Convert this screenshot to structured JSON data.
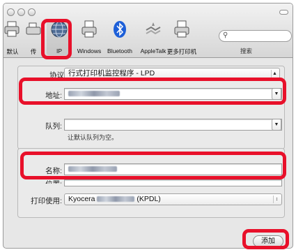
{
  "toolbar": {
    "items": [
      {
        "label": "默认"
      },
      {
        "label": "传"
      },
      {
        "label": "IP"
      },
      {
        "label": "Windows"
      },
      {
        "label": "Bluetooth"
      },
      {
        "label": "AppleTalk"
      },
      {
        "label": "更多打印机"
      }
    ],
    "search_label": "搜索"
  },
  "form": {
    "protocol_label": "协议:",
    "protocol_value": "行式打印机监控程序 - LPD",
    "address_label": "地址:",
    "queue_label": "队列:",
    "queue_hint": "让默认队列为空。",
    "name_label": "名称:",
    "location_label": "位置:",
    "print_using_label": "打印使用:",
    "print_using_value_prefix": "Kyocera",
    "print_using_value_suffix": "(KPDL)"
  },
  "buttons": {
    "add_label": "添加"
  },
  "colors": {
    "highlight": "#e8102a"
  }
}
